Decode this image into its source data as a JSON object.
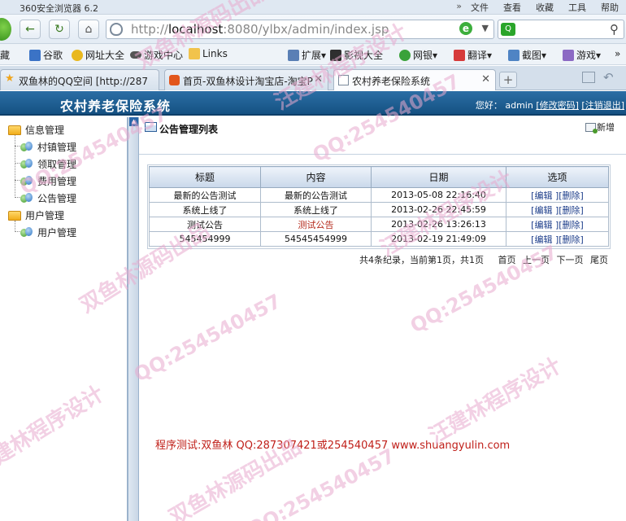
{
  "browser": {
    "app_title": "360安全浏览器 6.2",
    "menu": [
      "文件",
      "查看",
      "收藏",
      "工具",
      "帮助"
    ],
    "url_host": "localhost",
    "url_rest": ":8080/ylbx/admin/index.jsp",
    "url_prefix": "http://",
    "favorites": [
      {
        "label": "藏",
        "icon": "favorites-icon"
      },
      {
        "label": "谷歌",
        "icon": "google-icon"
      },
      {
        "label": "网址大全",
        "icon": "web-directory-icon"
      },
      {
        "label": "游戏中心",
        "icon": "gamepad-icon"
      },
      {
        "label": "Links",
        "icon": "folder-icon"
      },
      {
        "label": "扩展",
        "icon": "extension-icon"
      },
      {
        "label": "影视大全",
        "icon": "video-icon"
      },
      {
        "label": "网银",
        "icon": "bank-icon"
      },
      {
        "label": "翻译",
        "icon": "translate-icon"
      },
      {
        "label": "截图",
        "icon": "screenshot-icon"
      },
      {
        "label": "游戏",
        "icon": "game-icon"
      }
    ],
    "tabs": [
      {
        "label": "双鱼林的QQ空间 [http://287",
        "active": false
      },
      {
        "label": "首页-双鱼林设计淘宝店-淘宝P",
        "active": false
      },
      {
        "label": "农村养老保险系统",
        "active": true
      }
    ]
  },
  "app": {
    "title": "农村养老保险系统",
    "greeting": "您好：",
    "username": "admin",
    "change_password": "[修改密码]",
    "logout": "[注销退出]"
  },
  "sidebar": {
    "groups": [
      {
        "label": "信息管理",
        "items": [
          "村镇管理",
          "领取管理",
          "费用管理",
          "公告管理"
        ]
      },
      {
        "label": "用户管理",
        "items": [
          "用户管理"
        ]
      }
    ]
  },
  "main": {
    "title": "公告管理列表",
    "add_label": "新增",
    "columns": [
      "标题",
      "内容",
      "日期",
      "选项"
    ],
    "rows": [
      {
        "title": "最新的公告测试",
        "content": "最新的公告测试",
        "date": "2013-05-08 22:16:40"
      },
      {
        "title": "系统上线了",
        "content": "系统上线了",
        "date": "2013-02-26 22:45:59"
      },
      {
        "title": "测试公告",
        "content": "测试公告",
        "date": "2013-02-26 13:26:13"
      },
      {
        "title": "545454999",
        "content": "54545454999",
        "date": "2013-02-19 21:49:09"
      }
    ],
    "row_edit": "[编辑 ]",
    "row_delete": "[删除]",
    "pager_summary": "共4条纪录，当前第1页，共1页",
    "pager_links": [
      "首页",
      "上一页",
      "下一页",
      "尾页"
    ]
  },
  "footer": {
    "text": "程序测试:双鱼林 QQ:287307421或254540457 www.shuangyulin.com"
  },
  "watermark": {
    "texts": [
      "双鱼林源码出品",
      "QQ:254540457",
      "汪建林程序设计"
    ]
  }
}
